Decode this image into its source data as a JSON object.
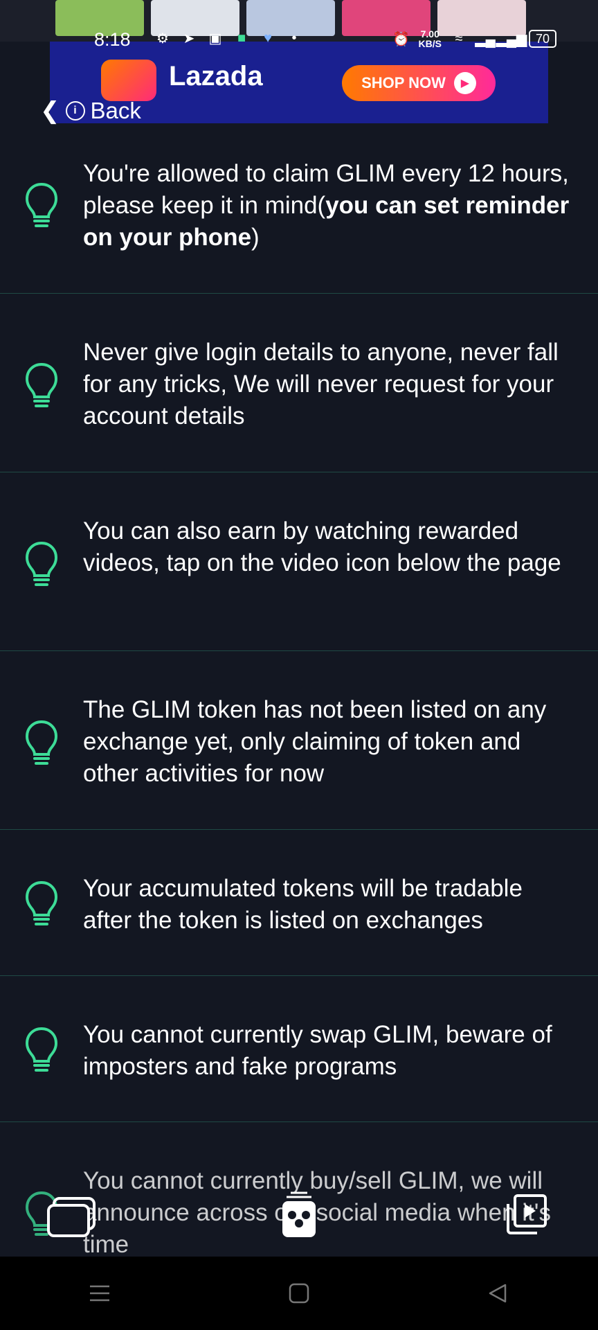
{
  "status_bar": {
    "time": "8:18",
    "net_speed_value": "7.00",
    "net_speed_unit": "KB/S",
    "battery": "70"
  },
  "ad": {
    "brand": "Lazada",
    "cta": "SHOP NOW"
  },
  "back_label": "Back",
  "tips": [
    {
      "text": "You're allowed to claim GLIM every 12 hours, please keep it in mind(",
      "bold": "you can set reminder on your phone",
      "suffix": ")"
    },
    {
      "text": "Never give login details to anyone, never fall for any tricks, We will never request for your account details"
    },
    {
      "text": "You can also earn by watching rewarded videos, tap on the video icon below the page"
    },
    {
      "text": "The GLIM token has not been listed on any exchange yet, only claiming of token and other activities for now"
    },
    {
      "text": "Your accumulated tokens will be tradable after the token is listed on exchanges"
    },
    {
      "text": "You cannot currently swap GLIM, beware of imposters and fake programs"
    },
    {
      "text": "You cannot currently buy/sell GLIM, we will announce across our social media when it's time"
    }
  ],
  "colors": {
    "background": "#131722",
    "accent": "#3ddc97",
    "divider": "#1f4a45"
  }
}
